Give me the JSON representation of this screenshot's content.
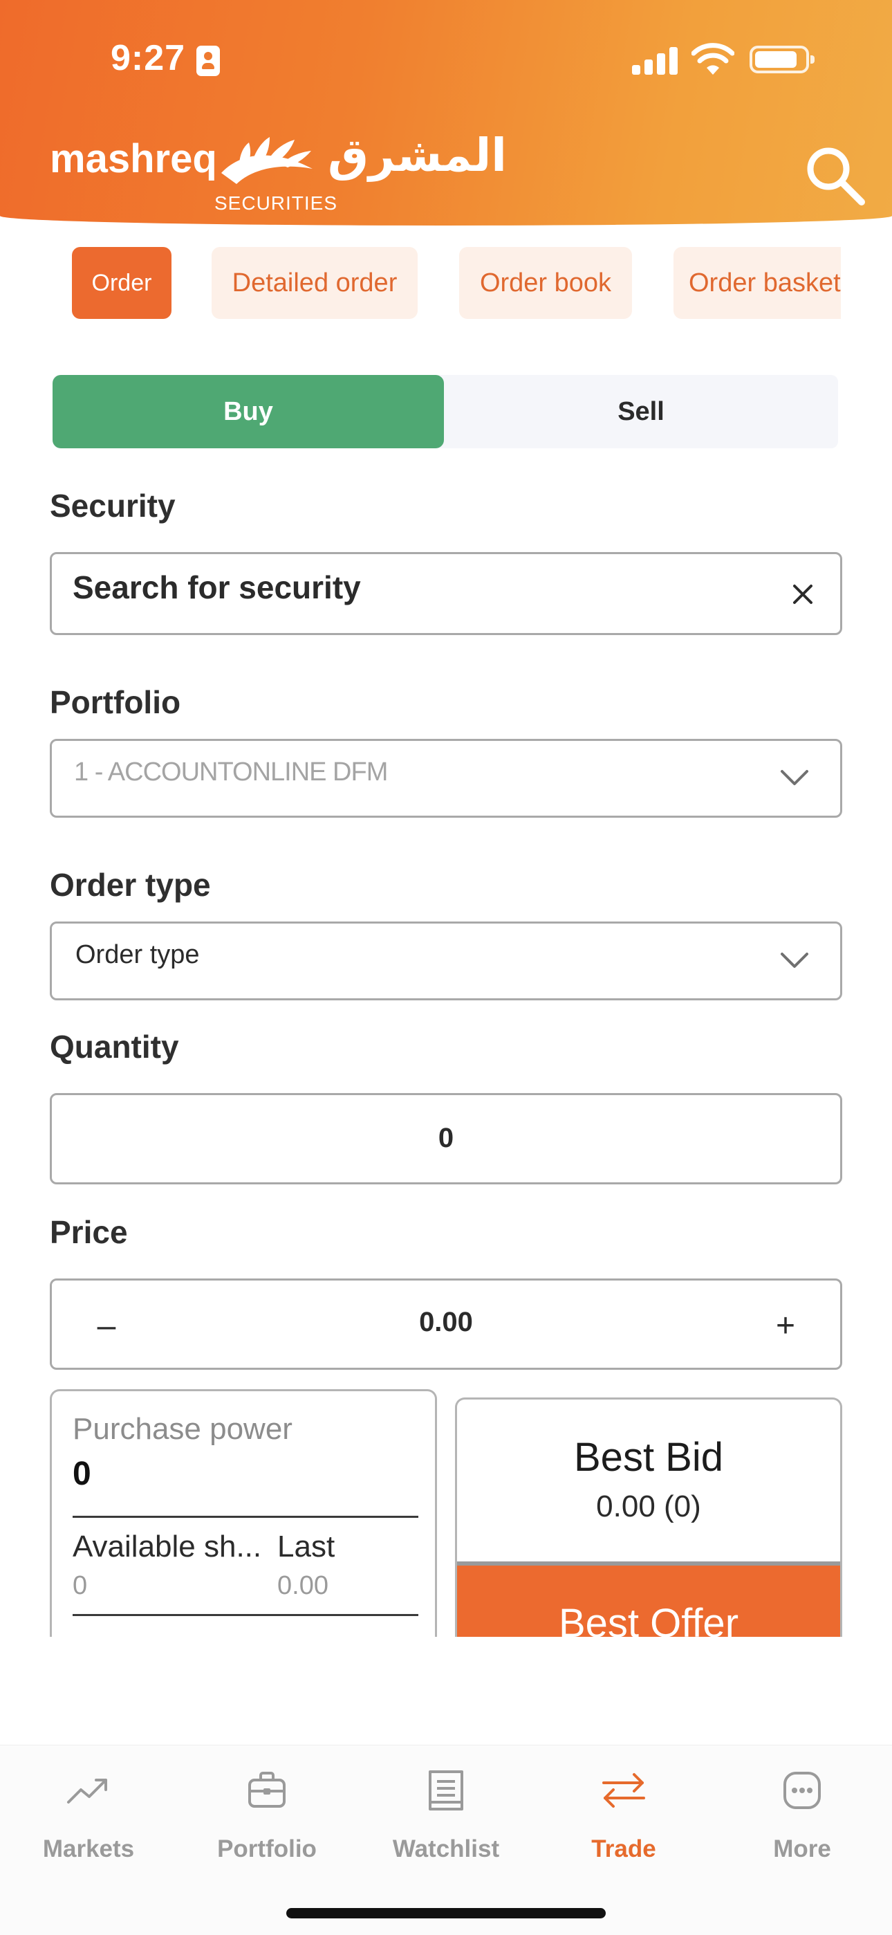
{
  "status_bar": {
    "time": "9:27"
  },
  "header": {
    "logo_en": "mashreq",
    "logo_ar": "المشرق",
    "logo_sub": "SECURITIES",
    "search_icon": "search-icon",
    "colors": {
      "gradient_start": "#ef6b2b",
      "gradient_end": "#f1ab45"
    }
  },
  "subtabs": [
    {
      "label": "Order",
      "active": true
    },
    {
      "label": "Detailed order",
      "active": false
    },
    {
      "label": "Order book",
      "active": false
    },
    {
      "label": "Order basket",
      "active": false
    }
  ],
  "side_toggle": {
    "buy_label": "Buy",
    "sell_label": "Sell",
    "selected": "Buy",
    "buy_color": "#4fa873"
  },
  "form": {
    "security": {
      "label": "Security",
      "placeholder": "Search for security"
    },
    "portfolio": {
      "label": "Portfolio",
      "value": "1 - ACCOUNTONLINE DFM"
    },
    "order_type": {
      "label": "Order type",
      "value": "Order type"
    },
    "quantity": {
      "label": "Quantity",
      "value": "0"
    },
    "price": {
      "label": "Price",
      "value": "0.00",
      "minus": "–",
      "plus": "+"
    }
  },
  "purchase_card": {
    "title": "Purchase power",
    "value": "0",
    "available_label": "Available sh...",
    "last_label": "Last",
    "available_value": "0",
    "last_value": "0.00"
  },
  "bid_card": {
    "best_bid_label": "Best Bid",
    "best_bid_value": "0.00 (0)",
    "best_offer_label": "Best Offer",
    "offer_color": "#ec6a2f"
  },
  "bottom_nav": [
    {
      "label": "Markets",
      "icon": "trending-up-icon",
      "active": false
    },
    {
      "label": "Portfolio",
      "icon": "briefcase-icon",
      "active": false
    },
    {
      "label": "Watchlist",
      "icon": "book-icon",
      "active": false
    },
    {
      "label": "Trade",
      "icon": "swap-arrows-icon",
      "active": true
    },
    {
      "label": "More",
      "icon": "more-dots-icon",
      "active": false
    }
  ],
  "accent_color": "#e66a2c"
}
